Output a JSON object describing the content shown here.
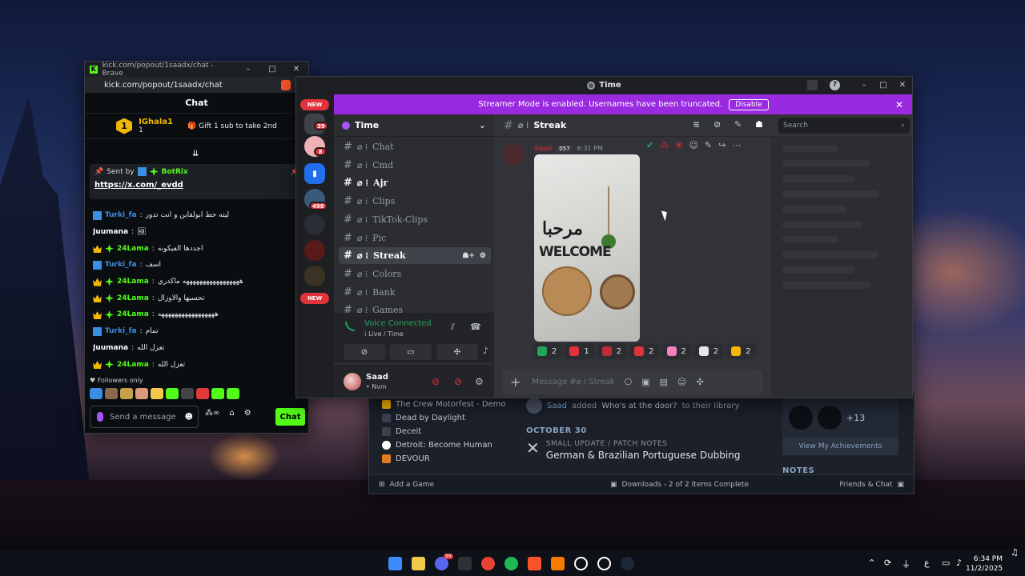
{
  "kick": {
    "url_title": "kick.com/popout/1saadx/chat - Brave",
    "url": "kick.com/popout/1saadx/chat",
    "chat_title": "Chat",
    "leader_rank": "1",
    "leader_name": "IGhala1",
    "leader_sub": "1",
    "gift_text": "Gift 1 sub to take 2nd",
    "pinned_by_label": "Sent by",
    "pinned_by": "BotRix",
    "pinned_link": "https://x.com/_evdd",
    "messages": [
      {
        "user": "Turki_fa",
        "badge": "blue",
        "color": "#3a8ee6",
        "text": "ليته حط ابولقاين و انت تدور"
      },
      {
        "user": "Juumana",
        "badge": "",
        "color": "#ffffff",
        "text": "🖼"
      },
      {
        "user": "24Lama",
        "badge": "crown-green",
        "color": "#53fc18",
        "text": "اجددها الفيكونه"
      },
      {
        "user": "Turki_fa",
        "badge": "blue",
        "color": "#3a8ee6",
        "text": "اسف"
      },
      {
        "user": "24Lama",
        "badge": "crown-green",
        "color": "#53fc18",
        "text": "هههههههههههههههههه ماكدري"
      },
      {
        "user": "24Lama",
        "badge": "crown-green",
        "color": "#53fc18",
        "text": "تحسبها والاوزال"
      },
      {
        "user": "24Lama",
        "badge": "crown-green",
        "color": "#53fc18",
        "text": "هههههههههههههههههه"
      },
      {
        "user": "Turki_fa",
        "badge": "blue",
        "color": "#3a8ee6",
        "text": "تمام"
      },
      {
        "user": "Juumana",
        "badge": "",
        "color": "#ffffff",
        "text": "تعزل الله"
      },
      {
        "user": "24Lama",
        "badge": "crown-green",
        "color": "#53fc18",
        "text": "تعزل الله"
      }
    ],
    "followers_only": "Followers only",
    "input_placeholder": "Send a message",
    "chat_button": "Chat",
    "tools_text": "∞"
  },
  "discord": {
    "window_title": "Time",
    "banner_text": "Streamer Mode is enabled. Usernames have been truncated.",
    "banner_button": "Disable",
    "servers": [
      {
        "kind": "new",
        "label": "NEW"
      },
      {
        "kind": "badge",
        "label": "39"
      },
      {
        "kind": "badge",
        "label": "8"
      },
      {
        "kind": "badge",
        "label": "498"
      },
      {
        "kind": "new",
        "label": "NEW"
      }
    ],
    "guild_name": "Time",
    "channels": [
      {
        "name": "Chat",
        "state": "normal"
      },
      {
        "name": "Cmd",
        "state": "normal"
      },
      {
        "name": "Ajr",
        "state": "unread"
      },
      {
        "name": "Clips",
        "state": "normal"
      },
      {
        "name": "TikTok-Clips",
        "state": "normal"
      },
      {
        "name": "Pic",
        "state": "normal"
      },
      {
        "name": "Streak",
        "state": "active"
      },
      {
        "name": "Colors",
        "state": "normal"
      },
      {
        "name": "Bank",
        "state": "normal"
      },
      {
        "name": "Games",
        "state": "normal"
      }
    ],
    "channel_prefix": "⌀ ⁞",
    "voice_status": "Voice Connected",
    "voice_channel": "⁞ Live / Time",
    "username": "Saad",
    "user_status": "• Nvm",
    "current_channel": "Streak",
    "search_placeholder": "Search",
    "message_tag": "057",
    "message_time": "6:31 PM",
    "photo_arabic": "مرحبا",
    "photo_welcome": "WELCOME",
    "reactions": [
      {
        "emoji": "check",
        "color": "#23a55a",
        "count": "2"
      },
      {
        "emoji": "cross",
        "color": "#e0323a",
        "count": "1"
      },
      {
        "emoji": "100",
        "color": "#c02b3a",
        "count": "2"
      },
      {
        "emoji": "bow",
        "color": "#e0323a",
        "count": "2"
      },
      {
        "emoji": "heart",
        "color": "#f47fbf",
        "count": "2"
      },
      {
        "emoji": "goat",
        "color": "#e6e6e6",
        "count": "2"
      },
      {
        "emoji": "sun",
        "color": "#f2b705",
        "count": "2"
      }
    ],
    "compose_placeholder": "Message #⌀ ⁞ Streak"
  },
  "steam": {
    "games": [
      "The Crew Motorfest - Demo",
      "Dead by Daylight",
      "Deceit",
      "Detroit: Become Human",
      "DEVOUR"
    ],
    "activity_user": "Saad",
    "activity_verb": "added",
    "activity_game": "Who's at the door?",
    "activity_suffix": "to their library",
    "date_header": "OCTOBER 30",
    "news_kind": "SMALL UPDATE / PATCH NOTES",
    "news_title": "German & Brazilian Portuguese Dubbing",
    "ach_count": "+13",
    "view_achievements": "View My Achievements",
    "notes_header": "NOTES",
    "add_game": "Add a Game",
    "downloads": "Downloads - 2 of 2 Items Complete",
    "friends": "Friends & Chat"
  },
  "taskbar": {
    "time": "6:34 PM",
    "date": "11/2/2025",
    "lang": "ع",
    "discord_badge": "99"
  }
}
